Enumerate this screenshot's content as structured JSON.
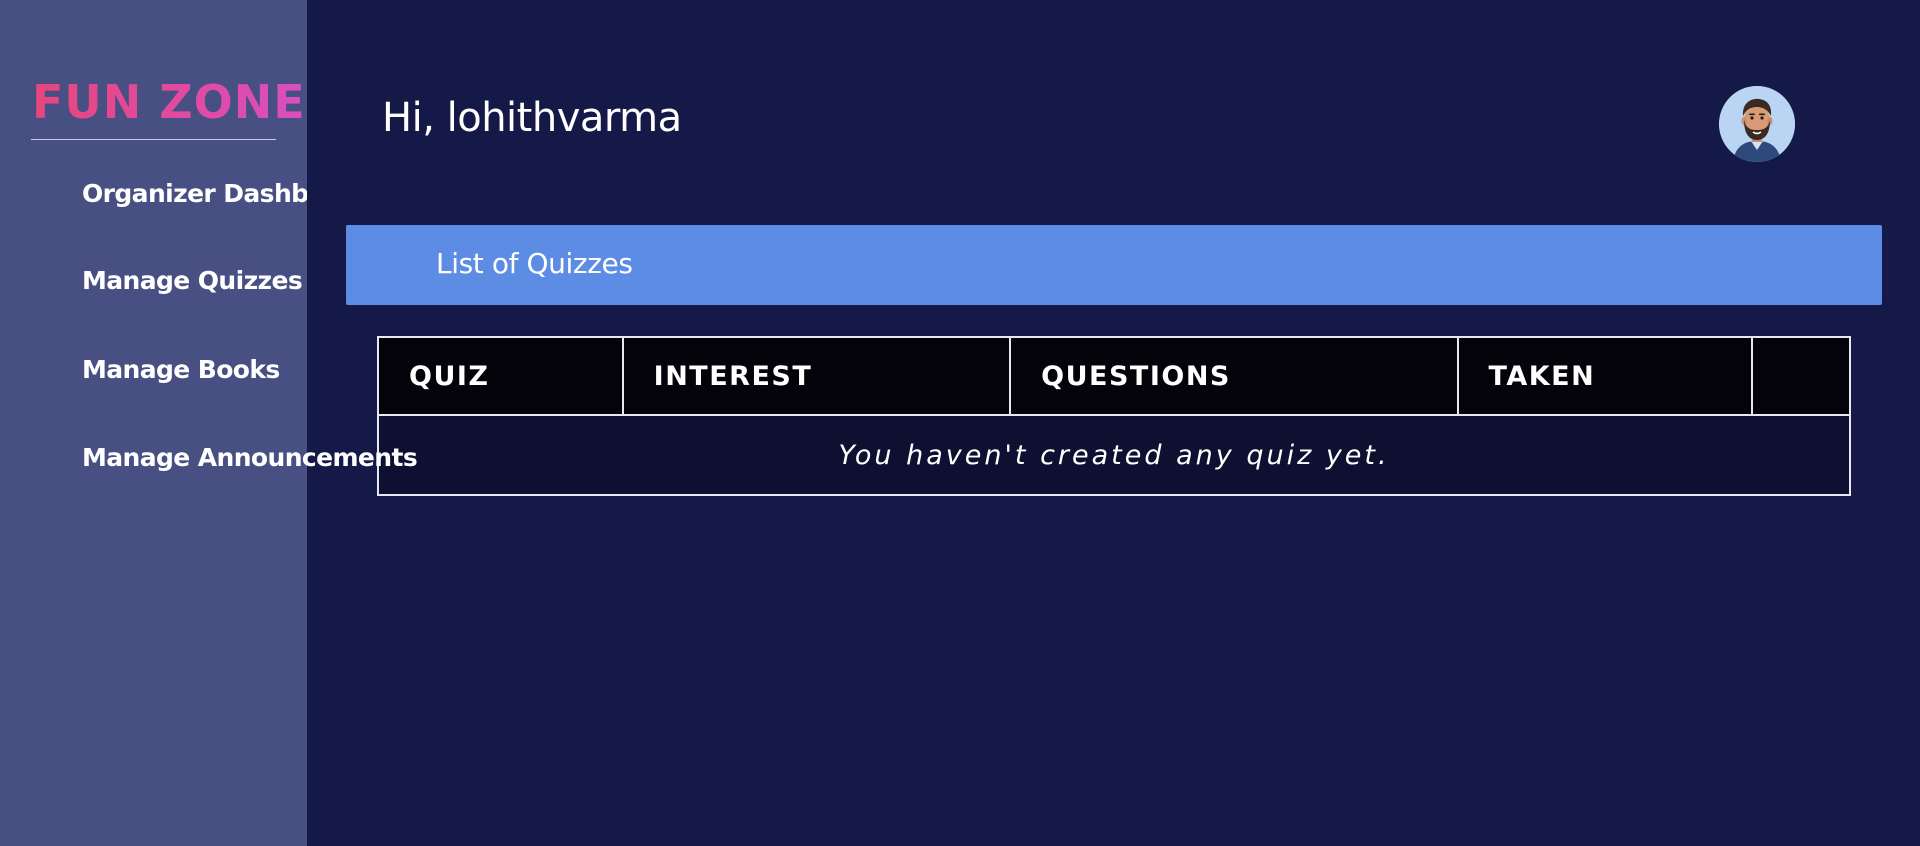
{
  "sidebar": {
    "brand": "FUN ZONE",
    "items": [
      {
        "label": "Organizer Dashboard"
      },
      {
        "label": "Manage Quizzes"
      },
      {
        "label": "Manage Books"
      },
      {
        "label": "Manage Announcements"
      }
    ]
  },
  "header": {
    "greeting": "Hi, lohithvarma",
    "avatar_icon": "bearded-man-avatar-icon"
  },
  "main": {
    "banner_title": "List of Quizzes",
    "table": {
      "columns": [
        "QUIZ",
        "INTEREST",
        "QUESTIONS",
        "TAKEN",
        ""
      ],
      "empty_message": "You haven't created any quiz yet."
    }
  },
  "colors": {
    "page_bg": "#151947",
    "sidebar_bg": "#484f82",
    "banner_bg": "#5d8ce5",
    "brand": "#e44b8d"
  }
}
